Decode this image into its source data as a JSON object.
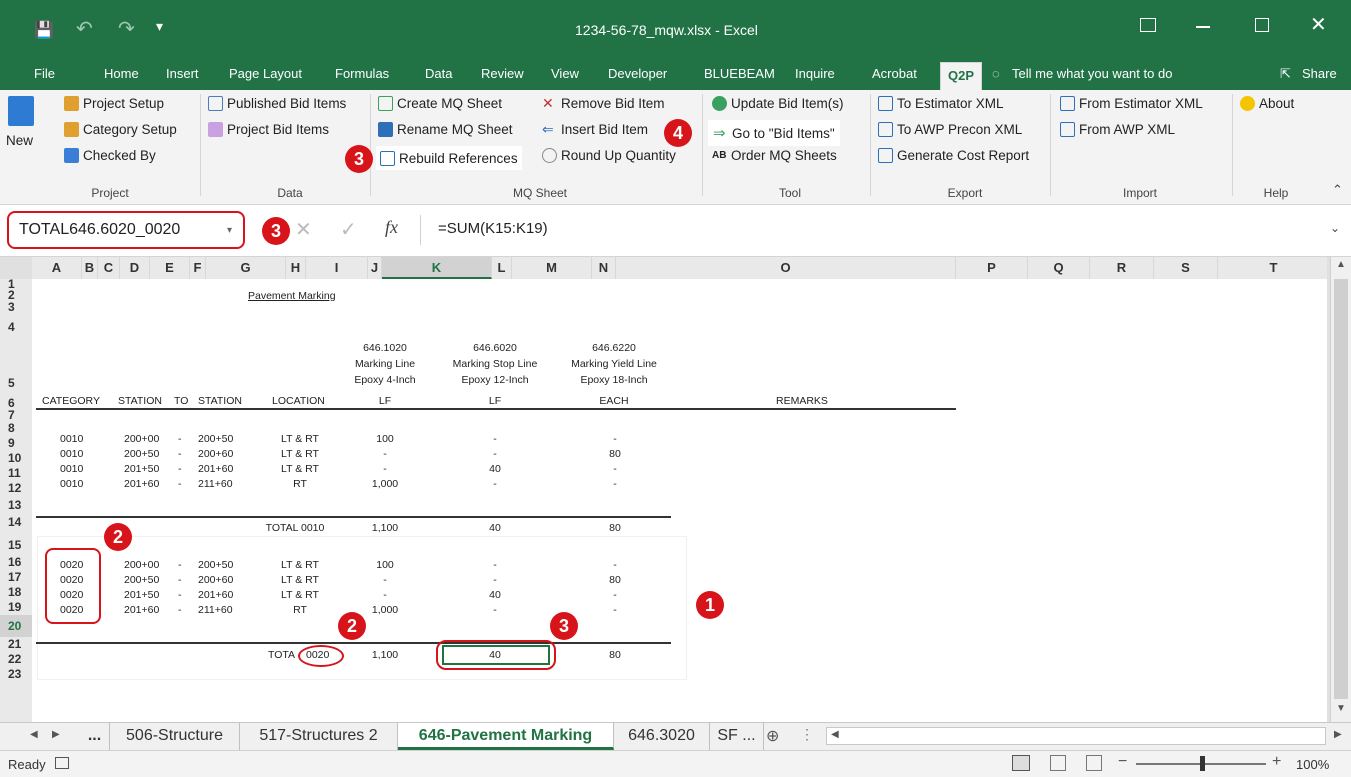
{
  "window": {
    "title": "1234-56-78_mqw.xlsx  -  Excel"
  },
  "quick_access": {
    "save": "💾",
    "undo": "↶",
    "redo": "↷",
    "customize": "▾"
  },
  "tabs": [
    "File",
    "Home",
    "Insert",
    "Page Layout",
    "Formulas",
    "Data",
    "Review",
    "View",
    "Developer",
    "BLUEBEAM",
    "Inquire",
    "Acrobat",
    "Q2P"
  ],
  "active_tab": "Q2P",
  "tell_me": "Tell me what you want to do",
  "share": "Share",
  "ribbon": {
    "project": {
      "new": "New",
      "items": [
        "Project Setup",
        "Category Setup",
        "Checked By"
      ],
      "label": "Project"
    },
    "data": {
      "items": [
        "Published Bid Items",
        "Project Bid Items"
      ],
      "label": "Data"
    },
    "mq_sheet": {
      "col1": [
        "Create MQ Sheet",
        "Rename MQ Sheet",
        "Rebuild References"
      ],
      "col2": [
        "Remove Bid Item",
        "Insert Bid Item",
        "Round Up Quantity"
      ],
      "label": "MQ Sheet"
    },
    "tool": {
      "items": [
        "Update Bid Item(s)",
        "Go to \"Bid Items\"",
        "Order MQ Sheets"
      ],
      "label": "Tool"
    },
    "export": {
      "items": [
        "To Estimator XML",
        "To AWP Precon XML",
        "Generate Cost Report"
      ],
      "label": "Export"
    },
    "import": {
      "items": [
        "From Estimator XML",
        "From AWP XML"
      ],
      "label": "Import"
    },
    "help": {
      "items": [
        "About"
      ],
      "label": "Help"
    }
  },
  "formula_bar": {
    "name_box": "TOTAL646.6020_0020",
    "fx": "fx",
    "formula": "=SUM(K15:K19)"
  },
  "columns": [
    "A",
    "B",
    "C",
    "D",
    "E",
    "F",
    "G",
    "H",
    "I",
    "J",
    "K",
    "L",
    "M",
    "N",
    "O",
    "P",
    "Q",
    "R",
    "S",
    "T"
  ],
  "rows": [
    "1",
    "2",
    "3",
    "4",
    "5",
    "6",
    "7",
    "8",
    "9",
    "10",
    "11",
    "12",
    "13",
    "14",
    "15",
    "16",
    "17",
    "18",
    "19",
    "20",
    "21",
    "22",
    "23"
  ],
  "sheet": {
    "title": "Pavement Marking",
    "headers": {
      "category": "CATEGORY",
      "station": "STATION",
      "to": "TO",
      "station2": "STATION",
      "location": "LOCATION",
      "remarks": "REMARKS"
    },
    "bid_items": [
      {
        "code": "646.1020",
        "desc1": "Marking Line",
        "desc2": "Epoxy 4-Inch",
        "unit": "LF"
      },
      {
        "code": "646.6020",
        "desc1": "Marking Stop Line",
        "desc2": "Epoxy 12-Inch",
        "unit": "LF"
      },
      {
        "code": "646.6220",
        "desc1": "Marking Yield Line",
        "desc2": "Epoxy 18-Inch",
        "unit": "EACH"
      }
    ],
    "group1": [
      {
        "cat": "0010",
        "from": "200+00",
        "dash": "-",
        "to": "200+50",
        "loc": "LT & RT",
        "i": "100",
        "k": "-",
        "m": "-"
      },
      {
        "cat": "0010",
        "from": "200+50",
        "dash": "-",
        "to": "200+60",
        "loc": "LT & RT",
        "i": "-",
        "k": "-",
        "m": "80"
      },
      {
        "cat": "0010",
        "from": "201+50",
        "dash": "-",
        "to": "201+60",
        "loc": "LT & RT",
        "i": "-",
        "k": "40",
        "m": "-"
      },
      {
        "cat": "0010",
        "from": "201+60",
        "dash": "-",
        "to": "211+60",
        "loc": "RT",
        "i": "1,000",
        "k": "-",
        "m": "-"
      }
    ],
    "total1": {
      "label": "TOTAL 0010",
      "i": "1,100",
      "k": "40",
      "m": "80"
    },
    "group2": [
      {
        "cat": "0020",
        "from": "200+00",
        "dash": "-",
        "to": "200+50",
        "loc": "LT & RT",
        "i": "100",
        "k": "-",
        "m": "-"
      },
      {
        "cat": "0020",
        "from": "200+50",
        "dash": "-",
        "to": "200+60",
        "loc": "LT & RT",
        "i": "-",
        "k": "-",
        "m": "80"
      },
      {
        "cat": "0020",
        "from": "201+50",
        "dash": "-",
        "to": "201+60",
        "loc": "LT & RT",
        "i": "-",
        "k": "40",
        "m": "-"
      },
      {
        "cat": "0020",
        "from": "201+60",
        "dash": "-",
        "to": "211+60",
        "loc": "RT",
        "i": "1,000",
        "k": "-",
        "m": "-"
      }
    ],
    "total2": {
      "label_a": "TOTA",
      "label_b": "0020",
      "i": "1,100",
      "k": "40",
      "m": "80"
    }
  },
  "badges": [
    "1",
    "2",
    "2",
    "3",
    "3",
    "3",
    "4"
  ],
  "sheet_tabs": [
    "...",
    "506-Structure",
    "517-Structures 2",
    "646-Pavement Marking",
    "646.3020",
    "SF ..."
  ],
  "active_sheet": "646-Pavement Marking",
  "status": {
    "ready": "Ready",
    "zoom": "100%"
  },
  "colors": {
    "excel_green": "#217346",
    "annotation_red": "#d7141a"
  }
}
